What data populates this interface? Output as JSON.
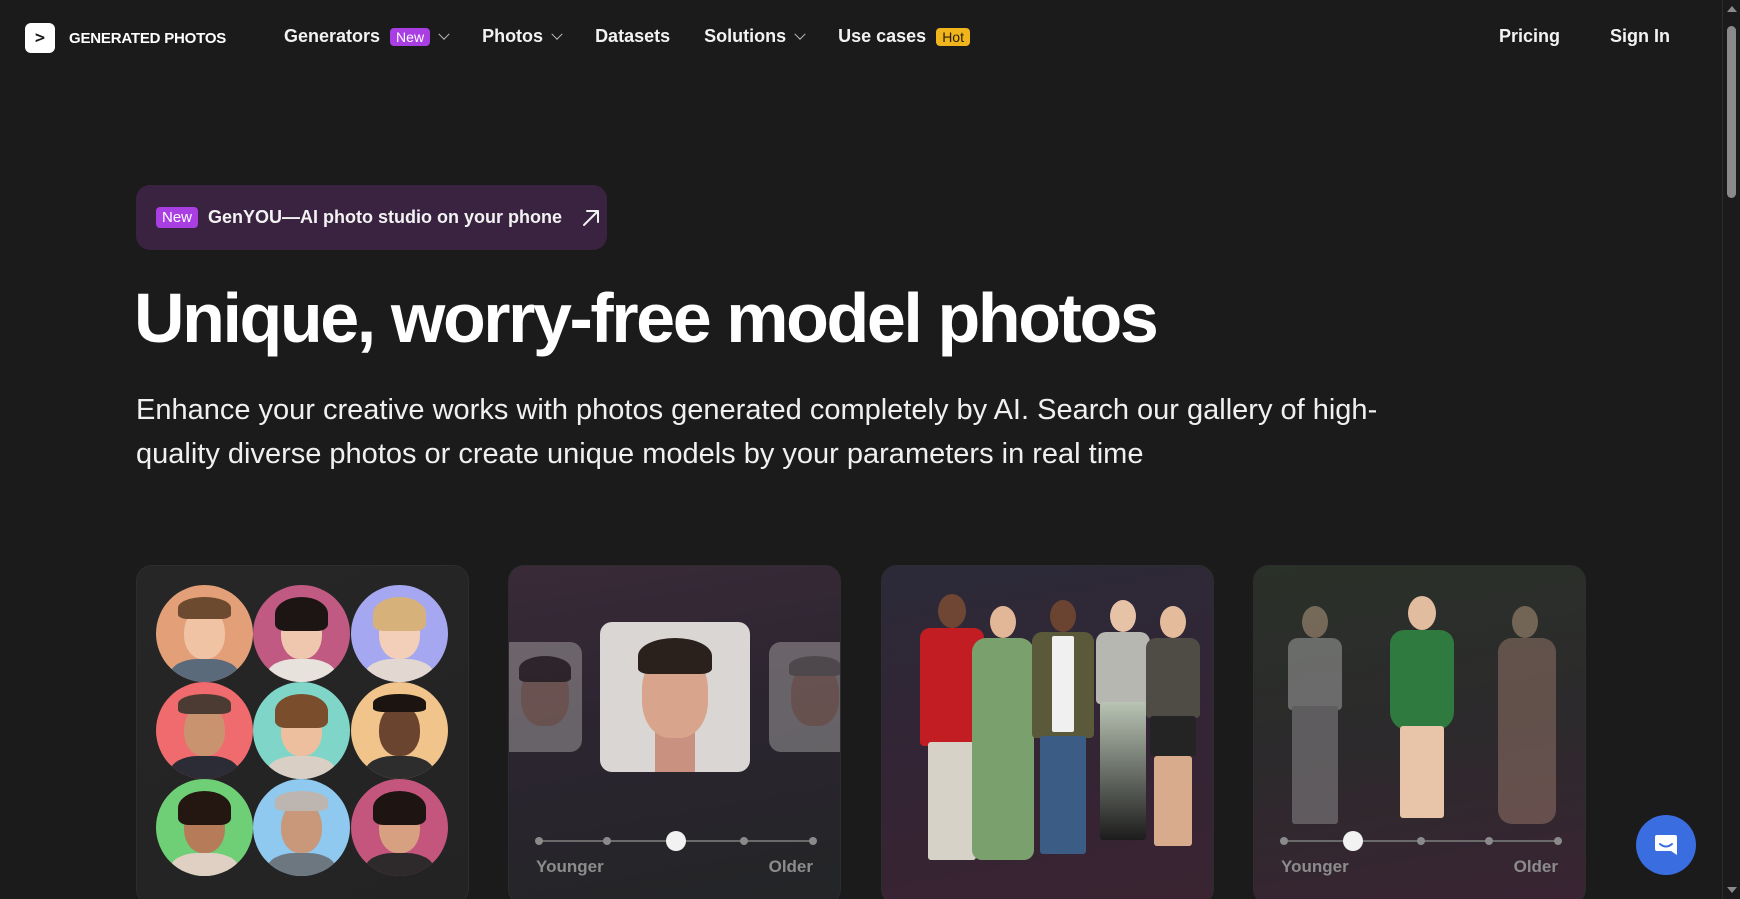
{
  "brand": {
    "name": "GENERATED PHOTOS",
    "logo_glyph": ">"
  },
  "nav": {
    "items": [
      {
        "label": "Generators",
        "badge": "New",
        "has_dropdown": true
      },
      {
        "label": "Photos",
        "badge": "",
        "has_dropdown": true
      },
      {
        "label": "Datasets",
        "badge": "",
        "has_dropdown": false
      },
      {
        "label": "Solutions",
        "badge": "",
        "has_dropdown": true
      },
      {
        "label": "Use cases",
        "badge": "Hot",
        "has_dropdown": false
      }
    ],
    "pricing": "Pricing",
    "sign_in": "Sign In"
  },
  "promo": {
    "badge": "New",
    "text": "GenYOU—AI photo studio on your phone",
    "icon": "arrow-up-right-icon"
  },
  "hero": {
    "title": "Unique, worry-free model photos",
    "subtitle": "Enhance your creative works with photos generated completely by AI. Search our gallery of high-quality diverse photos or create unique models by your parameters in real time"
  },
  "cards": {
    "face_slider": {
      "min_label": "Younger",
      "max_label": "Older",
      "position": 0.5
    },
    "body_slider": {
      "min_label": "Younger",
      "max_label": "Older",
      "position": 0.25
    }
  },
  "colors": {
    "background": "#1b1b1b",
    "badge_new": "#a93ee3",
    "badge_hot": "#f0b41c",
    "promo_bg": "#3a2340",
    "chat_button": "#3a6ddf"
  },
  "chat": {
    "icon": "chat-bubble-icon"
  }
}
